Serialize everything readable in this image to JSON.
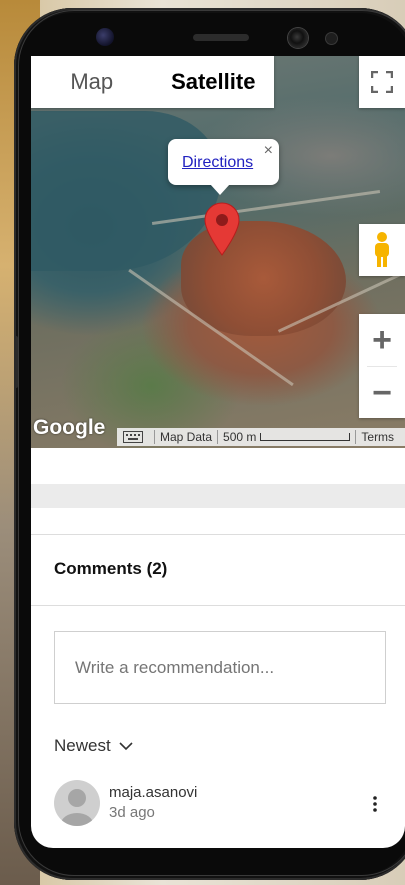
{
  "map": {
    "tabs": [
      {
        "label": "Map",
        "active": false
      },
      {
        "label": "Satellite",
        "active": true
      }
    ],
    "infowindow": {
      "link_label": "Directions",
      "close_glyph": "×"
    },
    "zoom": {
      "in": "+",
      "out": "−"
    },
    "google_logo": "Google",
    "attribution": {
      "map_data": "Map Data",
      "scale": "500 m",
      "terms": "Terms"
    }
  },
  "comments": {
    "title": "Comments (2)",
    "input_placeholder": "Write a recommendation...",
    "sort_label": "Newest",
    "items": [
      {
        "user": "maja.asanovi",
        "time": "3d ago"
      }
    ]
  },
  "colors": {
    "link": "#2222c0",
    "pin": "#e53935"
  },
  "icons": {
    "fullscreen": "fullscreen-icon",
    "pegman": "pegman-icon",
    "pin": "map-pin-icon",
    "keyboard": "keyboard-icon",
    "chevron": "chevron-down-icon",
    "more": "more-vertical-icon",
    "avatar": "default-avatar-icon"
  }
}
